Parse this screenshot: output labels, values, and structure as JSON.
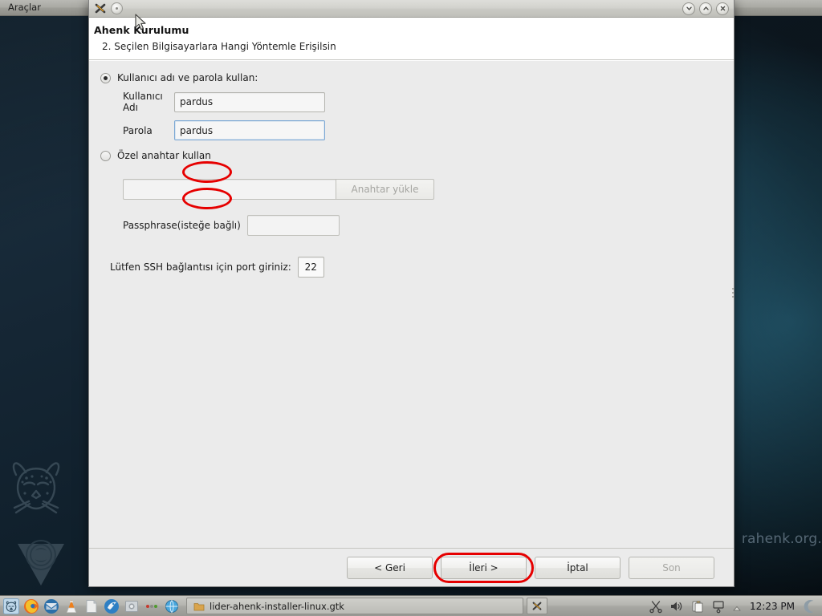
{
  "desktop": {
    "top_panel": {
      "menu_label": "Araçlar"
    },
    "watermark": "rahenk.org.",
    "logos": [
      "pardus-leopard-logo",
      "pardus-triangle-logo"
    ]
  },
  "window": {
    "titlebar": {
      "app_icon": "app-icon",
      "menu_button": "window-menu-icon",
      "minimize": "chevron-down-icon",
      "maximize": "chevron-up-icon",
      "close": "close-icon"
    },
    "header": {
      "title": "Ahenk Kurulumu",
      "subtitle": "2. Seçilen Bilgisayarlara Hangi Yöntemle Erişilsin"
    },
    "form": {
      "option_password": {
        "label": "Kullanıcı adı ve parola kullan:",
        "selected": true
      },
      "username": {
        "label": "Kullanıcı Adı",
        "value": "pardus",
        "placeholder": ""
      },
      "password": {
        "label": "Parola",
        "value": "pardus",
        "placeholder": ""
      },
      "option_key": {
        "label": "Özel anahtar kullan",
        "selected": false
      },
      "key_path": {
        "value": "",
        "placeholder": ""
      },
      "key_upload_button": "Anahtar yükle",
      "passphrase": {
        "label": "Passphrase(isteğe bağlı)",
        "value": "",
        "placeholder": ""
      },
      "port": {
        "label": "Lütfen SSH bağlantısı için port giriniz:",
        "value": "22"
      }
    },
    "buttons": {
      "back": "< Geri",
      "next": "İleri >",
      "cancel": "İptal",
      "finish": "Son"
    },
    "annotations": {
      "highlight_color": "#e60000",
      "targets": [
        "username-field",
        "password-field",
        "next-button"
      ]
    }
  },
  "taskbar": {
    "launchers": [
      "pardus-menu-icon",
      "firefox-icon",
      "thunderbird-icon",
      "vlc-icon",
      "file-manager-icon",
      "konqueror-icon",
      "image-viewer-icon",
      "dots-icon",
      "globe-icon"
    ],
    "task_entry": {
      "icon": "folder-icon",
      "title": "lider-ahenk-installer-linux.gtk"
    },
    "task_entry2_icon": "app-icon",
    "systray": [
      "scissors-icon",
      "volume-icon",
      "klipper-icon",
      "network-icon",
      "show-hidden-icon"
    ],
    "clock": "12:23 PM",
    "trailing_icon": "moon-icon"
  }
}
